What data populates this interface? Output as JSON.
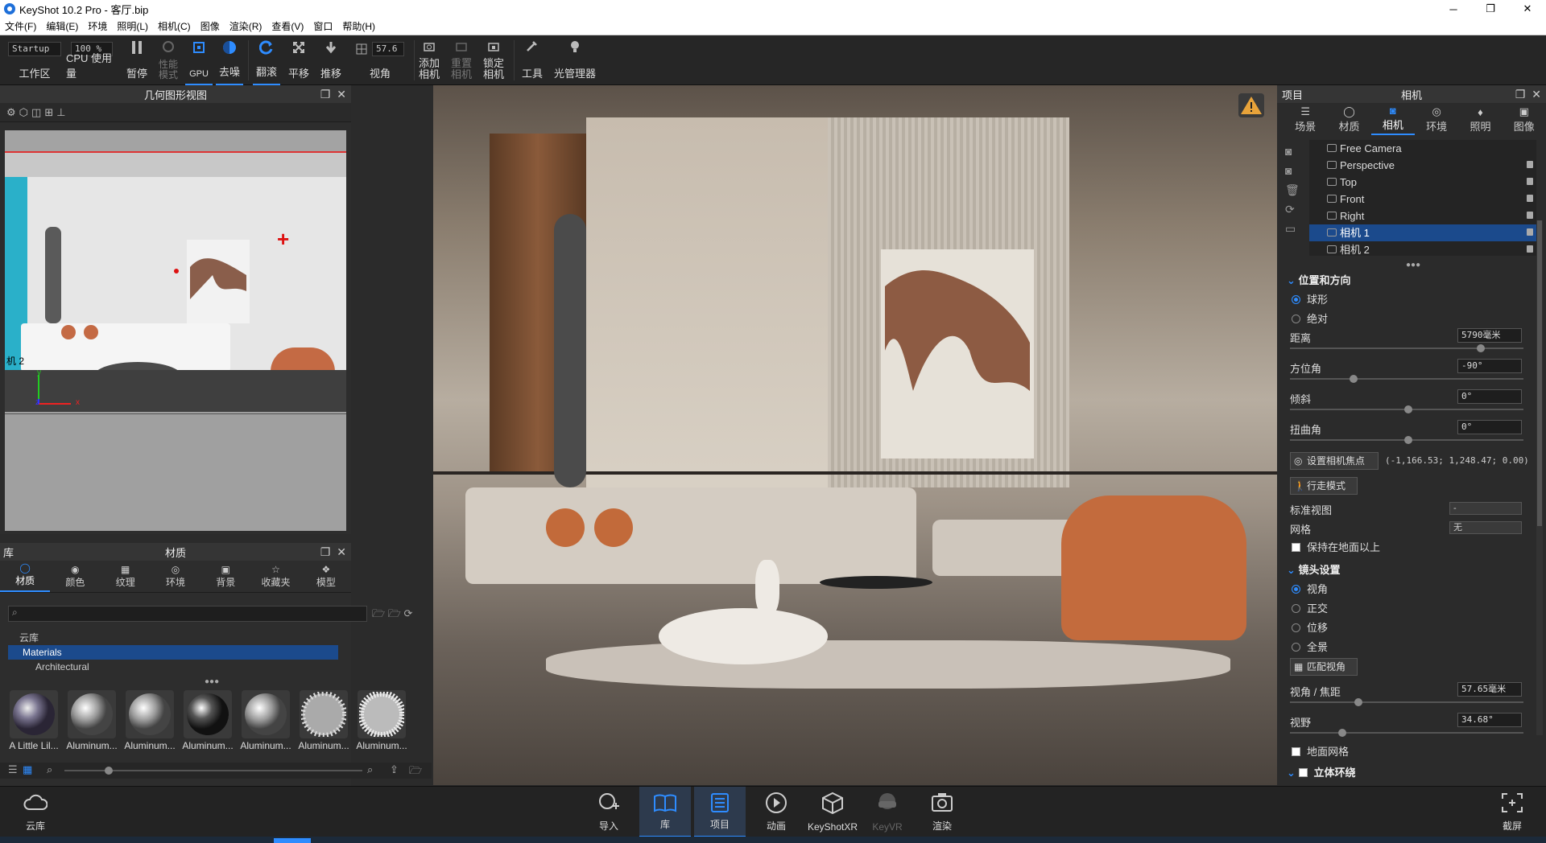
{
  "window": {
    "title": "KeyShot 10.2 Pro  - 客厅.bip",
    "minimize": "─",
    "maximize": "❐",
    "close": "✕"
  },
  "menu": [
    "文件(F)",
    "编辑(E)",
    "环境",
    "照明(L)",
    "相机(C)",
    "图像",
    "渲染(R)",
    "查看(V)",
    "窗口",
    "帮助(H)"
  ],
  "toolbar": {
    "workspace_value": "Startup",
    "workspace_label": "工作区",
    "cpu_value": "100 %",
    "cpu_label": "CPU 使用量",
    "pause": "暂停",
    "perf": "性能\n模式",
    "gpu": "GPU",
    "denoise": "去噪",
    "tumble": "翻滚",
    "pan": "平移",
    "dolly": "推移",
    "fov_value": "57.6",
    "fov_label": "视角",
    "add_camera": "添加\n相机",
    "reset_camera": "重置\n相机",
    "lock_camera": "锁定\n相机",
    "tools": "工具",
    "light_manager": "光管理器"
  },
  "geometry": {
    "title": "几何图形视图",
    "camera_label": "机 2",
    "axis_y": "y",
    "axis_x": "x",
    "axis_z": "z"
  },
  "library": {
    "section": "库",
    "title": "材质",
    "tabs": [
      "材质",
      "颜色",
      "纹理",
      "环境",
      "背景",
      "收藏夹",
      "模型"
    ],
    "tree": [
      "云库",
      "Materials",
      "Architectural"
    ],
    "thumbs": [
      "A Little Lil...",
      "Aluminum...",
      "Aluminum...",
      "Aluminum...",
      "Aluminum...",
      "Aluminum...",
      "Aluminum..."
    ]
  },
  "project": {
    "section": "项目",
    "title": "相机",
    "tabs": [
      "场景",
      "材质",
      "相机",
      "环境",
      "照明",
      "图像"
    ],
    "cameras": [
      "Free Camera",
      "Perspective",
      "Top",
      "Front",
      "Right",
      "相机 1",
      "相机 2"
    ],
    "selected_camera": "相机 1",
    "pos_section": "位置和方向",
    "radio_sphere": "球形",
    "radio_absolute": "绝对",
    "distance_label": "距离",
    "distance_value": "5790毫米",
    "azimuth_label": "方位角",
    "azimuth_value": "-90°",
    "incline_label": "倾斜",
    "incline_value": "0°",
    "twist_label": "扭曲角",
    "twist_value": "0°",
    "focus_button": "设置相机焦点",
    "focus_coords": "(-1,166.53; 1,248.47; 0.00)",
    "walk_button": "行走模式",
    "std_view_label": "标准视图",
    "std_view_value": "-",
    "grid_label": "网格",
    "grid_value": "无",
    "keep_ground": "保持在地面以上",
    "lens_section": "镜头设置",
    "lens_persp": "视角",
    "lens_ortho": "正交",
    "lens_shift": "位移",
    "lens_pano": "全景",
    "match_button": "匹配视角",
    "focal_label": "视角 / 焦距",
    "focal_value": "57.65毫米",
    "fov_label": "视野",
    "fov_value": "34.68°",
    "ground_grid": "地面网格",
    "stereo_section": "立体环绕"
  },
  "bottom": {
    "cloud": "云库",
    "import": "导入",
    "library": "库",
    "project": "项目",
    "animation": "动画",
    "keyshotxr": "KeyShotXR",
    "keyvr": "KeyVR",
    "render": "渲染",
    "screenshot": "截屏"
  },
  "colors": {
    "accent": "#2e8cff",
    "selected": "#1b4a8c",
    "warning": "#e8a33a"
  }
}
